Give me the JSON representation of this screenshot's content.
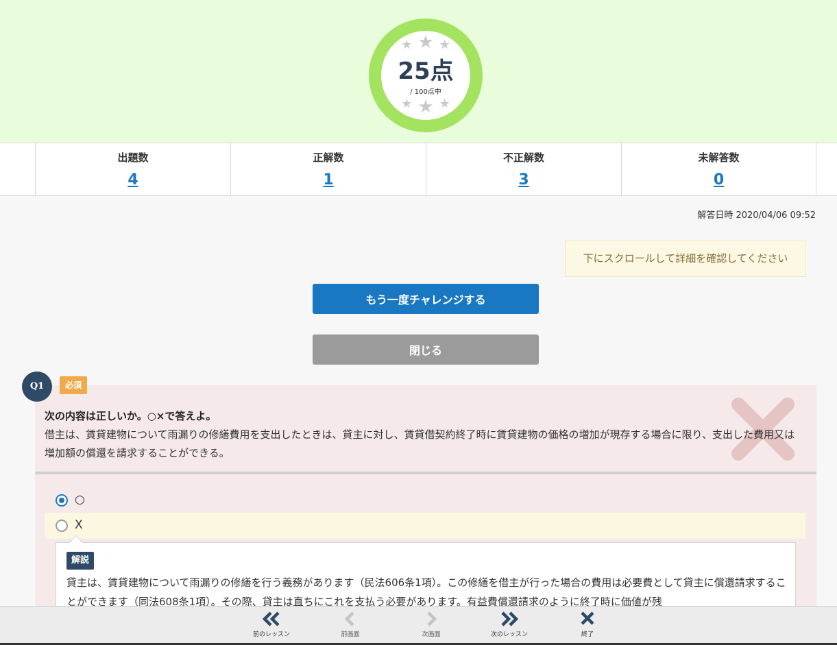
{
  "score": {
    "value": "25点",
    "max": "/ 100点中"
  },
  "stats": [
    {
      "label": "出題数",
      "value": "4"
    },
    {
      "label": "正解数",
      "value": "1"
    },
    {
      "label": "不正解数",
      "value": "3"
    },
    {
      "label": "未解答数",
      "value": "0"
    }
  ],
  "answered_at": "解答日時 2020/04/06 09:52",
  "notice": "下にスクロールして詳細を確認してください",
  "buttons": {
    "retry": "もう一度チャレンジする",
    "close": "閉じる"
  },
  "question": {
    "number": "Q1",
    "tag": "必須",
    "prompt": "次の内容は正しいか。○×で答えよ。",
    "text": "借主は、賃貸建物について雨漏りの修繕費用を支出したときは、貸主に対し、賃貸借契約終了時に賃貸建物の価格の増加が現存する場合に限り、支出した費用又は増加額の償還を請求することができる。",
    "choices": [
      {
        "label": "○",
        "selected": true,
        "correct": false
      },
      {
        "label": "X",
        "selected": false,
        "correct": true
      }
    ],
    "explanation_tag": "解説",
    "explanation": "貸主は、賃貸建物について雨漏りの修繕を行う義務があります（民法606条1項）。この修繕を借主が行った場合の費用は必要費として貸主に償還請求することができます（同法608条1項）。その際、貸主は直ちにこれを支払う必要があります。有益費償還請求のように終了時に価値が残"
  },
  "nav": {
    "prev_lesson": "前のレッスン",
    "prev_page": "前画面",
    "next_page": "次画面",
    "next_lesson": "次のレッスン",
    "end": "終了"
  },
  "colors": {
    "accent": "#1a78c2",
    "score_ring": "#a3e35f",
    "header_bg": "#e9fcdb",
    "wrong_mark": "#e5c4c4",
    "question_bg": "#f5e9e9",
    "badge": "#2e4a67",
    "required": "#f0a94b"
  },
  "icons": {
    "stars": "star-icon",
    "wrong": "cross-icon",
    "prev_lesson": "double-chevron-left-icon",
    "prev_page": "chevron-left-icon",
    "next_page": "chevron-right-icon",
    "next_lesson": "double-chevron-right-icon",
    "end": "close-icon"
  }
}
